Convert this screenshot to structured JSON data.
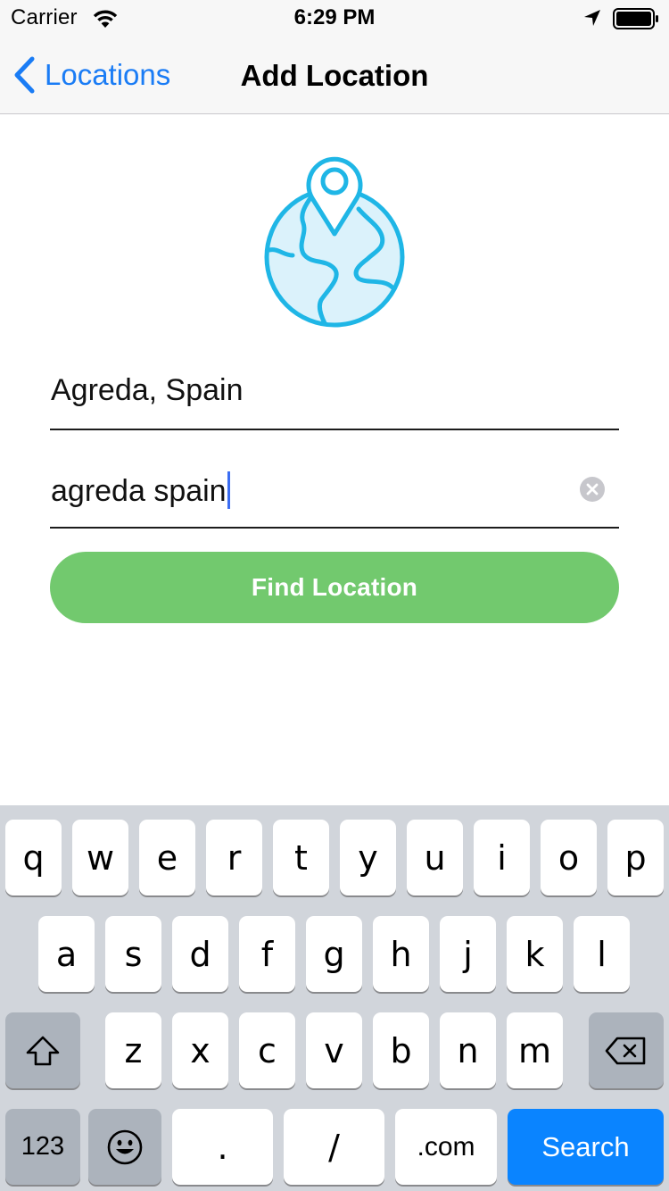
{
  "status_bar": {
    "carrier": "Carrier",
    "time": "6:29 PM"
  },
  "nav": {
    "back_label": "Locations",
    "title": "Add Location"
  },
  "form": {
    "location_name_value": "Agreda, Spain",
    "search_query_value": "agreda spain",
    "find_button_label": "Find Location"
  },
  "keyboard": {
    "row1": [
      "q",
      "w",
      "e",
      "r",
      "t",
      "y",
      "u",
      "i",
      "o",
      "p"
    ],
    "row2": [
      "a",
      "s",
      "d",
      "f",
      "g",
      "h",
      "j",
      "k",
      "l"
    ],
    "row3": [
      "z",
      "x",
      "c",
      "v",
      "b",
      "n",
      "m"
    ],
    "numbers_label": "123",
    "period_label": ".",
    "slash_label": "/",
    "dotcom_label": ".com",
    "return_label": "Search"
  },
  "colors": {
    "accent": "#1a7cf5",
    "button": "#72c96e",
    "globe": "#1fb6e6",
    "return_key": "#0a84ff"
  },
  "icons": [
    "wifi-icon",
    "location-arrow-icon",
    "battery-icon",
    "back-chevron-icon",
    "globe-pin-icon",
    "clear-text-icon",
    "shift-icon",
    "emoji-icon",
    "delete-icon"
  ]
}
